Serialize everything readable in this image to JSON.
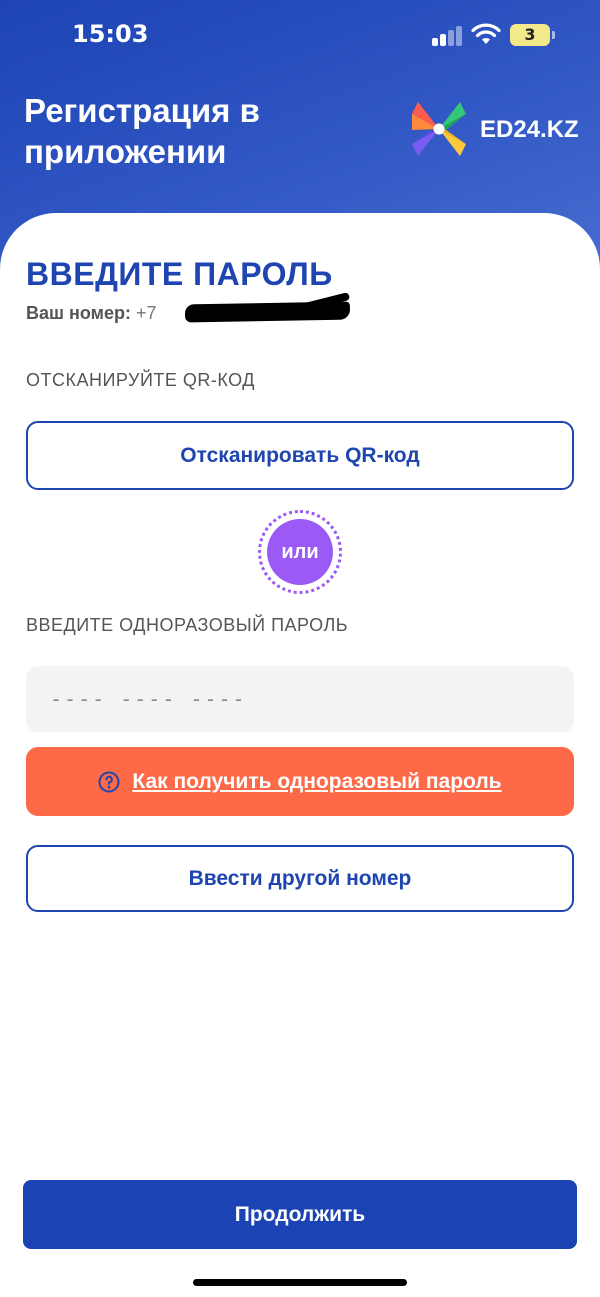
{
  "status_bar": {
    "time": "15:03",
    "battery": "3"
  },
  "header": {
    "title": "Регистрация в приложении",
    "logo_text": "ED24.KZ"
  },
  "form": {
    "title": "ВВЕДИТЕ ПАРОЛЬ",
    "phone_label": "Ваш номер:",
    "phone_prefix": "+7",
    "qr_section_label": "ОТСКАНИРУЙТЕ QR-КОД",
    "scan_qr_button": "Отсканировать QR-код",
    "or_label": "или",
    "otp_section_label": "ВВЕДИТЕ ОДНОРАЗОВЫЙ ПАРОЛЬ",
    "otp_placeholder": "---- ---- ----",
    "otp_value": "",
    "help_link": "Как получить одноразовый пароль",
    "other_number_button": "Ввести другой номер",
    "continue_button": "Продолжить"
  },
  "colors": {
    "primary": "#1e45b0",
    "accent": "#fe6947",
    "or_badge": "#9b59f5",
    "input_bg": "#f3f3f3"
  },
  "icons": [
    "signal-icon",
    "wifi-icon",
    "battery-icon",
    "app-logo-icon",
    "question-circle-icon"
  ]
}
